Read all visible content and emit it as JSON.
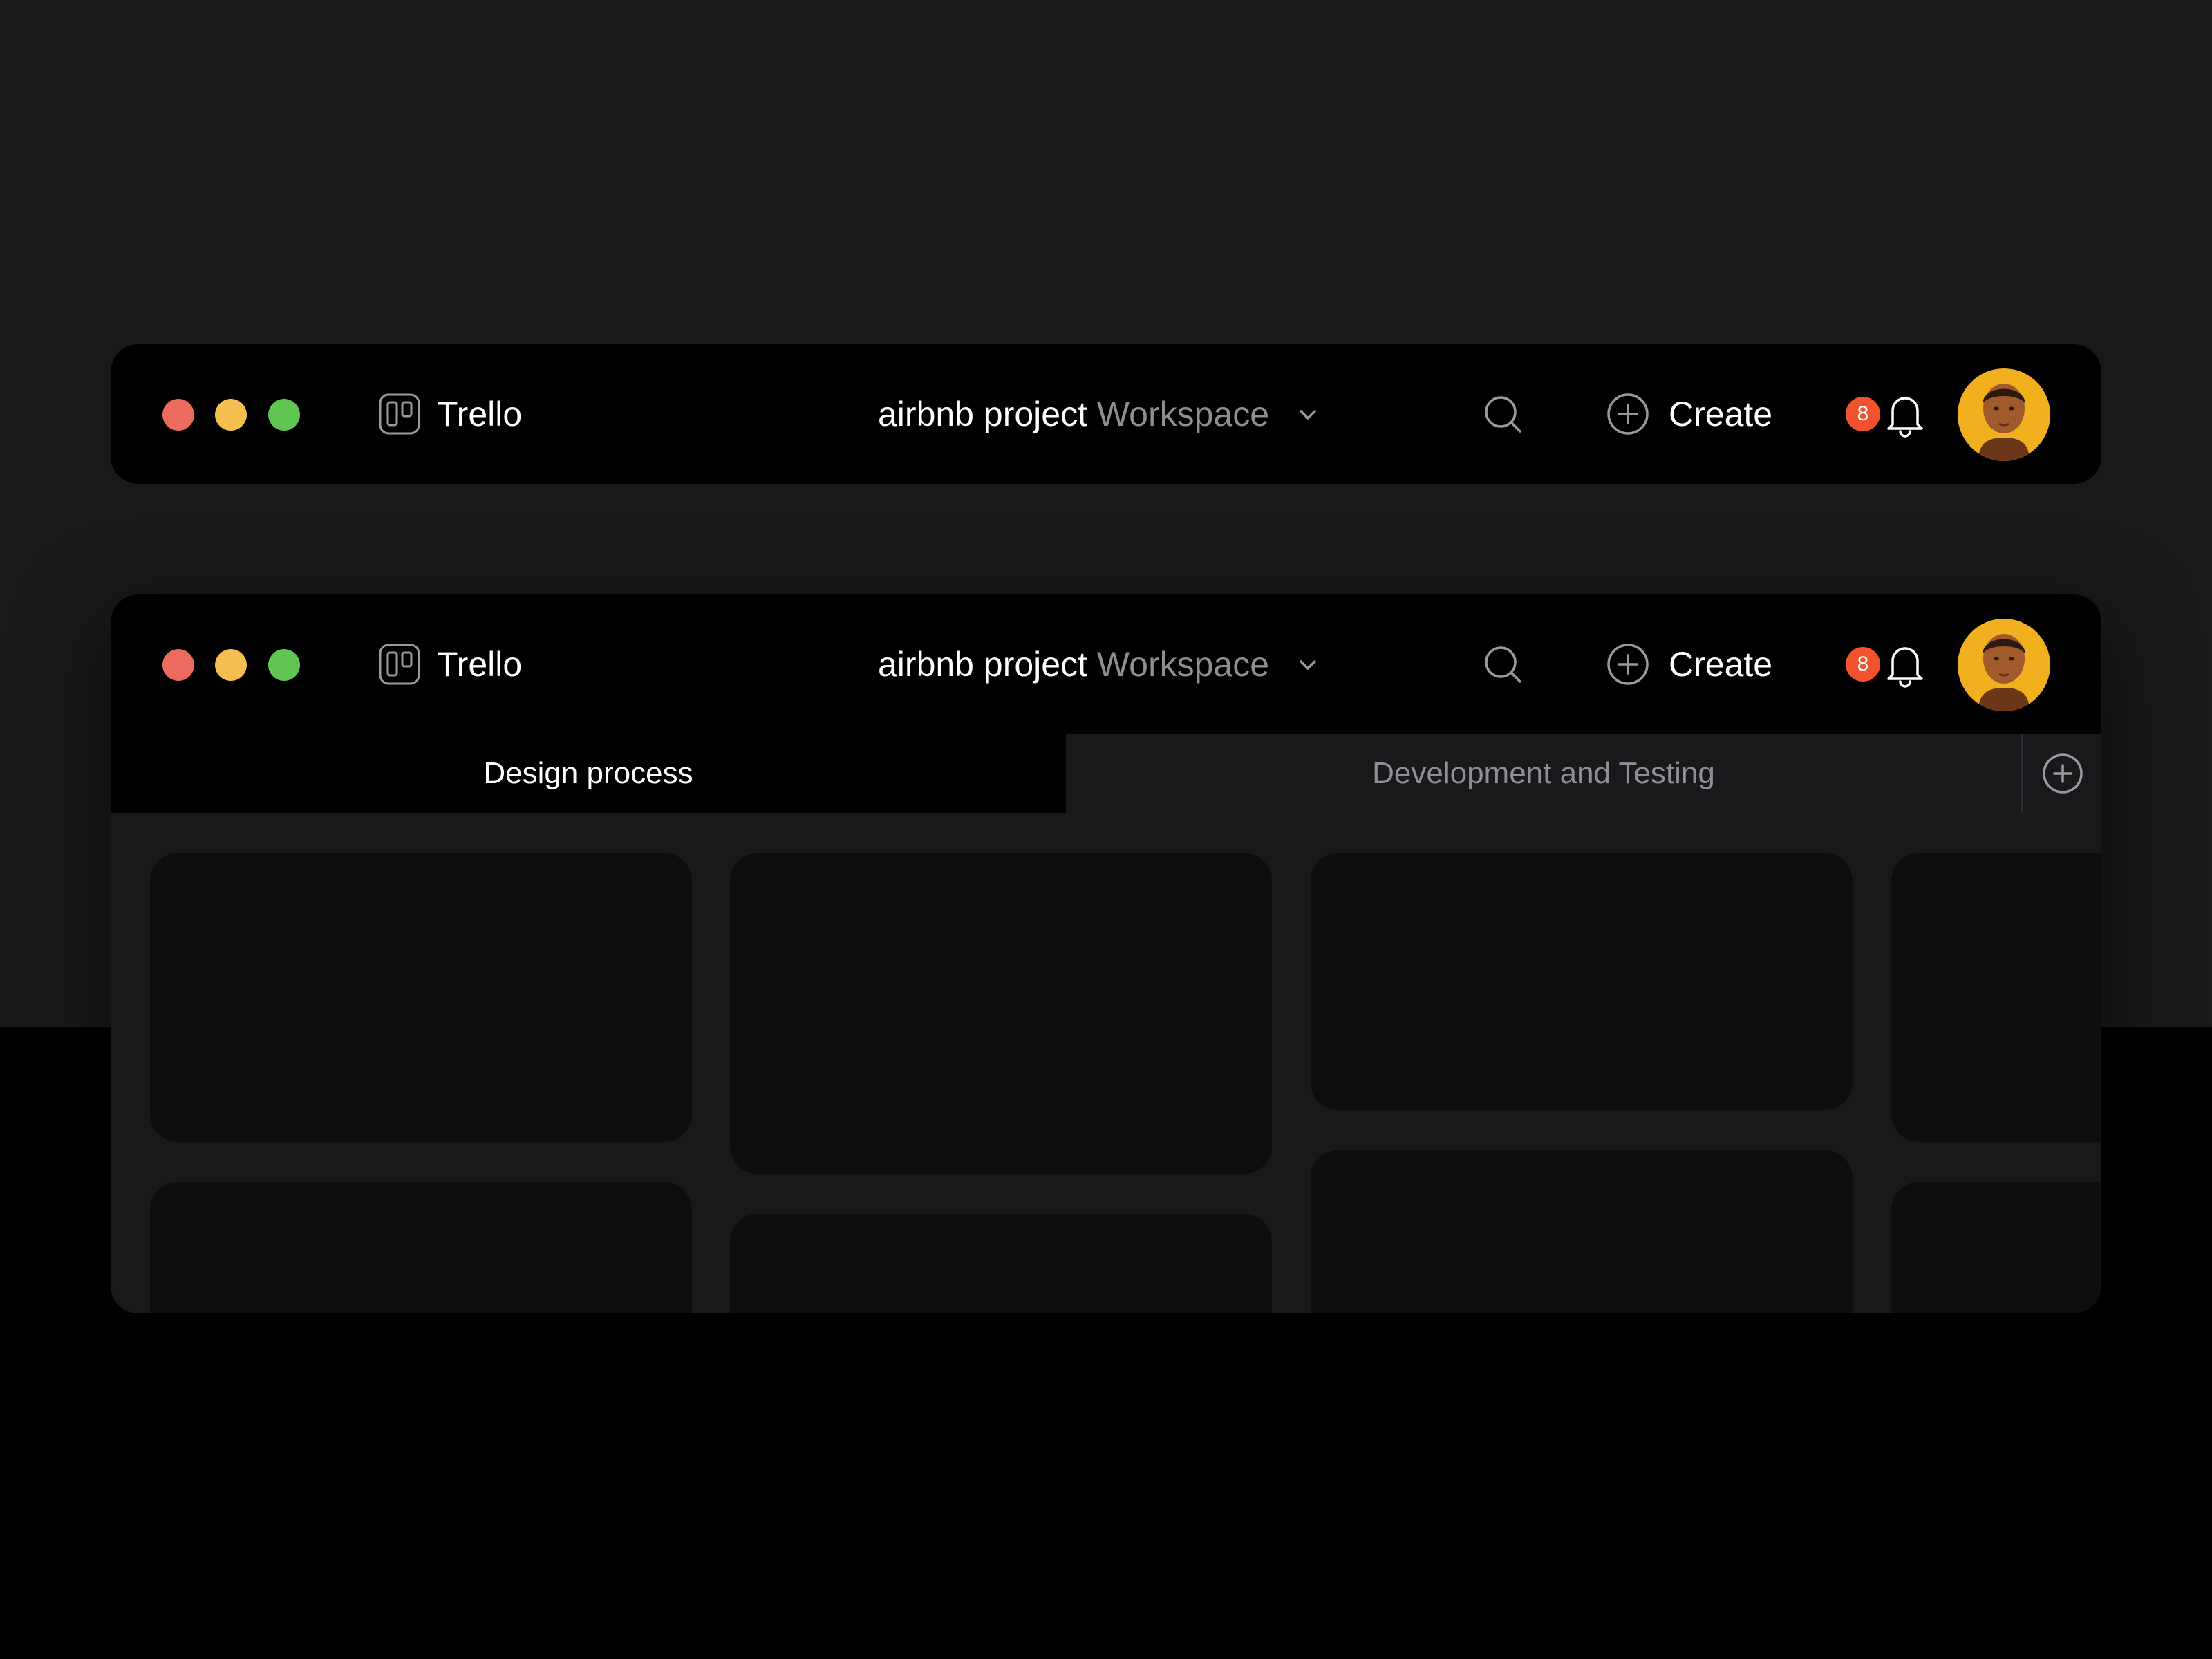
{
  "colors": {
    "background": "#18191b",
    "window": "#000000",
    "card": "#0c0d0f",
    "traffic_red": "#ec6a5e",
    "traffic_yellow": "#f4bf4f",
    "traffic_green": "#61c554",
    "badge": "#f2532f",
    "muted_text": "#8e8e93",
    "avatar_bg": "#f2b01e"
  },
  "icons": {
    "logo": "trello-board-icon",
    "workspace_dropdown": "chevron-down-icon",
    "search": "search-icon",
    "create": "plus-circle-icon",
    "notifications": "bell-icon",
    "add_tab": "plus-circle-icon"
  },
  "windows": [
    {
      "app_name": "Trello",
      "workspace": {
        "project": "airbnb project",
        "suffix": "Workspace"
      },
      "create_label": "Create",
      "notification_count": "8"
    },
    {
      "app_name": "Trello",
      "workspace": {
        "project": "airbnb project",
        "suffix": "Workspace"
      },
      "create_label": "Create",
      "notification_count": "8",
      "tabs": [
        {
          "label": "Design process",
          "active": true
        },
        {
          "label": "Development and Testing",
          "active": false
        }
      ]
    }
  ]
}
